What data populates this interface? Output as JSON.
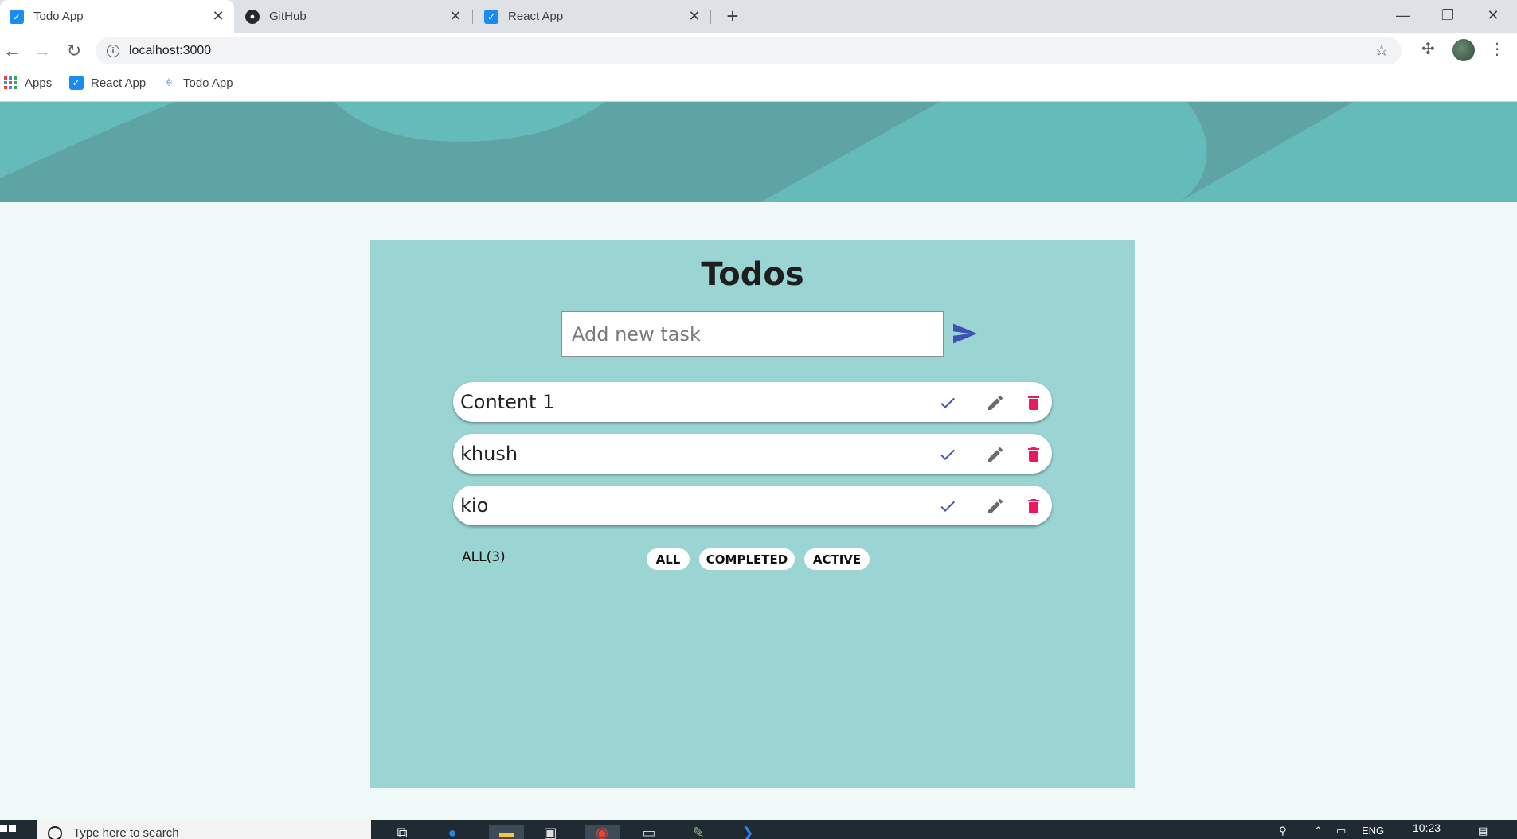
{
  "browser": {
    "tabs": [
      {
        "title": "Todo App",
        "icon": "todo-favicon",
        "active": true
      },
      {
        "title": "GitHub",
        "icon": "github-favicon",
        "active": false
      },
      {
        "title": "React App",
        "icon": "todo-favicon",
        "active": false
      }
    ],
    "url": "localhost:3000",
    "bookmarks": [
      {
        "label": "Apps",
        "icon": "apps-grid-icon"
      },
      {
        "label": "React App",
        "icon": "todo-favicon"
      },
      {
        "label": "Todo App",
        "icon": "react-atom-icon"
      }
    ]
  },
  "app": {
    "title": "Todos",
    "input_placeholder": "Add new task",
    "todos": [
      {
        "text": "Content 1"
      },
      {
        "text": "khush"
      },
      {
        "text": "kio"
      }
    ],
    "count_label": "ALL(3)",
    "filters": [
      "ALL",
      "COMPLETED",
      "ACTIVE"
    ]
  },
  "taskbar": {
    "search_placeholder": "Type here to search",
    "clock": "10:23",
    "language": "ENG"
  },
  "colors": {
    "hero": "#65baba",
    "card": "#9ad4d3",
    "check_icon": "#3f51b5",
    "edit_icon": "#6b6b6b",
    "delete_icon": "#e8195d",
    "send_icon": "#3f51b5"
  }
}
